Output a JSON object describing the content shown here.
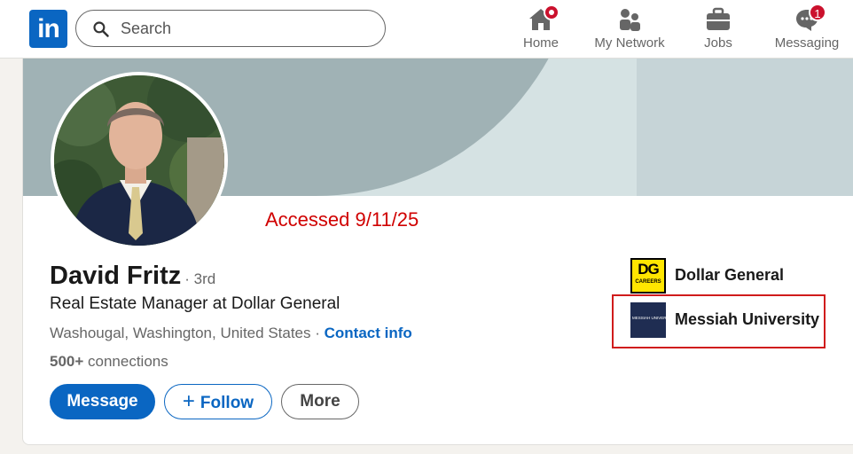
{
  "nav": {
    "logo_text": "in",
    "search_placeholder": "Search",
    "items": [
      {
        "label": "Home",
        "icon": "home-icon",
        "badge": ""
      },
      {
        "label": "My Network",
        "icon": "network-icon",
        "badge": ""
      },
      {
        "label": "Jobs",
        "icon": "briefcase-icon",
        "badge": ""
      },
      {
        "label": "Messaging",
        "icon": "messaging-icon",
        "badge": "1"
      }
    ]
  },
  "annotation": {
    "accessed": "Accessed 9/11/25",
    "highlight_color": "#d01c1c"
  },
  "profile": {
    "name": "David Fritz",
    "degree": "· 3rd",
    "headline": "Real Estate Manager at Dollar General",
    "location": "Washougal, Washington, United States",
    "location_separator": " · ",
    "contact_label": "Contact info",
    "connections_count": "500+",
    "connections_label": " connections"
  },
  "actions": {
    "message": "Message",
    "follow_plus": "+",
    "follow": "Follow",
    "more": "More"
  },
  "orgs": [
    {
      "name": "Dollar General",
      "logo_text": "DG",
      "logo_sub": "CAREERS",
      "logo_color": "#ffe600"
    },
    {
      "name": "Messiah University",
      "logo_text": "MESSIAH UNIVERSITY",
      "logo_color": "#1f2d52"
    }
  ],
  "colors": {
    "brand": "#0a66c2",
    "badge": "#cb112d",
    "annotation": "#d00000"
  }
}
